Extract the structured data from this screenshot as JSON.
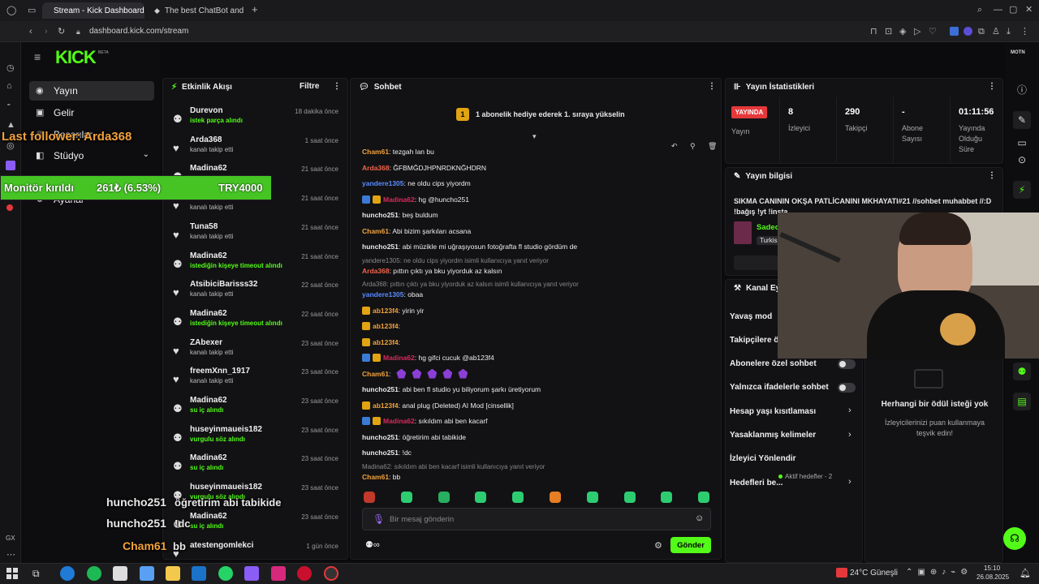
{
  "browser": {
    "tabs": [
      {
        "title": "Stream - Kick Dashboard"
      },
      {
        "title": "The best ChatBot and"
      }
    ],
    "new_tab": "+",
    "url": "dashboard.kick.com/stream"
  },
  "site": {
    "logo": "KICK",
    "beta": "BETA",
    "nav": [
      {
        "label": "Yayın",
        "icon": "broadcast-icon"
      },
      {
        "label": "Gelir",
        "icon": "wallet-icon"
      },
      {
        "label": "Başarılar",
        "icon": "trophy-icon"
      },
      {
        "label": "Stüdyo",
        "icon": "studio-icon"
      },
      {
        "label": "Ayarlar",
        "icon": "gear-icon"
      }
    ]
  },
  "activity": {
    "title": "Etkinlik Akışı",
    "filter": "Filtre",
    "items": [
      {
        "name": "Durevon",
        "sub": "istek parça alındı",
        "time": "18 dakika önce",
        "highlight": true,
        "icon": "reward-icon"
      },
      {
        "name": "Arda368",
        "sub": "kanalı takip etti",
        "time": "1 saat önce",
        "highlight": false,
        "icon": "heart-icon"
      },
      {
        "name": "Madina62",
        "sub": "",
        "time": "21 saat önce",
        "highlight": false,
        "icon": "reward-icon"
      },
      {
        "name": "Madina62",
        "sub": "kanalı takip etti",
        "time": "21 saat önce",
        "highlight": false,
        "icon": "heart-icon"
      },
      {
        "name": "Tuna58",
        "sub": "kanalı takip etti",
        "time": "21 saat önce",
        "highlight": false,
        "icon": "heart-icon"
      },
      {
        "name": "Madina62",
        "sub": "istediğin kişeye timeout alındı",
        "time": "21 saat önce",
        "highlight": true,
        "icon": "reward-icon"
      },
      {
        "name": "AtsibiciBarisss32",
        "sub": "kanalı takip etti",
        "time": "22 saat önce",
        "highlight": false,
        "icon": "heart-icon"
      },
      {
        "name": "Madina62",
        "sub": "istediğin kişeye timeout alındı",
        "time": "22 saat önce",
        "highlight": true,
        "icon": "reward-icon"
      },
      {
        "name": "ZAbexer",
        "sub": "kanalı takip etti",
        "time": "23 saat önce",
        "highlight": false,
        "icon": "heart-icon"
      },
      {
        "name": "freemXnn_1917",
        "sub": "kanalı takip etti",
        "time": "23 saat önce",
        "highlight": false,
        "icon": "heart-icon"
      },
      {
        "name": "Madina62",
        "sub": "su iç alındı",
        "time": "23 saat önce",
        "highlight": true,
        "icon": "reward-icon"
      },
      {
        "name": "huseyinmaueis182",
        "sub": "vurgulu söz alındı",
        "time": "23 saat önce",
        "highlight": true,
        "icon": "reward-icon"
      },
      {
        "name": "Madina62",
        "sub": "su iç alındı",
        "time": "23 saat önce",
        "highlight": true,
        "icon": "reward-icon"
      },
      {
        "name": "huseyinmaueis182",
        "sub": "vurgulu söz alındı",
        "time": "23 saat önce",
        "highlight": true,
        "icon": "reward-icon"
      },
      {
        "name": "Madina62",
        "sub": "su iç alındı",
        "time": "23 saat önce",
        "highlight": true,
        "icon": "reward-icon"
      },
      {
        "name": "atestengomlekci",
        "sub": "",
        "time": "1 gün önce",
        "highlight": false,
        "icon": "heart-icon"
      }
    ]
  },
  "chat": {
    "title": "Sohbet",
    "goal_number": "1",
    "goal_text": "1 abonelik hediye ederek 1. sıraya yükselin",
    "messages": [
      {
        "user": "Cham61",
        "color": "#f2a23c",
        "text": ": tezgah lan bu",
        "badges": []
      },
      {
        "user": "Arda368",
        "color": "#f0644a",
        "text": ": ĞFBMĞDJHPNRDKNĞHDRN",
        "badges": []
      },
      {
        "user": "yandere1305",
        "color": "#5b8cff",
        "text": ": ne oldu cips yiyordm",
        "badges": []
      },
      {
        "user": "Madina62",
        "color": "#d92a5c",
        "text": ": hg @huncho251",
        "badges": [
          "#3b7bd6",
          "#e2a312"
        ]
      },
      {
        "user": "huncho251",
        "color": "#e8e8e8",
        "text": ": beş buldum",
        "badges": []
      },
      {
        "user": "Cham61",
        "color": "#f2a23c",
        "text": ": Abi bizim şarkıları acsana",
        "badges": []
      },
      {
        "user": "huncho251",
        "color": "#e8e8e8",
        "text": ": abi müzikle mi uğraşıyosun fotoğrafta fl studio gördüm de",
        "badges": []
      },
      {
        "reply": "yandere1305: ne oldu cips yiyordm isimli kullanıcıya yanıt veriyor",
        "user": "Arda368",
        "color": "#f0644a",
        "text": ": pıttın çıktı ya bku yiyorduk az kalsın",
        "badges": []
      },
      {
        "reply": "Arda368: pıttın çıktı ya bku yiyorduk az kalsın isimli kullanıcıya yanıt veriyor",
        "user": "yandere1305",
        "color": "#5b8cff",
        "text": ": obaa",
        "badges": []
      },
      {
        "user": "ab123f4",
        "color": "#f2a23c",
        "text": ": yirin yir",
        "badges": [
          "#e2a312"
        ]
      },
      {
        "user": "ab123f4",
        "color": "#f2a23c",
        "text": ": ",
        "badges": [
          "#e2a312"
        ]
      },
      {
        "user": "ab123f4",
        "color": "#f2a23c",
        "text": ": ",
        "badges": [
          "#e2a312"
        ]
      },
      {
        "user": "Madina62",
        "color": "#d92a5c",
        "text": ": hg gifci cucuk @ab123f4",
        "badges": [
          "#3b7bd6",
          "#e2a312"
        ]
      },
      {
        "user": "Cham61",
        "color": "#f2a23c",
        "text": ":",
        "badges": []
      },
      {
        "user": "huncho251",
        "color": "#e8e8e8",
        "text": ": abi ben fl studio yu biliyorum şarkı üretiyorum",
        "badges": []
      },
      {
        "user": "ab123f4",
        "color": "#f2a23c",
        "text": ": anal plug (Deleted)  AI Mod  [cinsellik]",
        "badges": [
          "#e2a312"
        ]
      },
      {
        "user": "Madina62",
        "color": "#d92a5c",
        "text": ": sıkıldım abi ben kacarf",
        "badges": [
          "#3b7bd6",
          "#e2a312"
        ]
      },
      {
        "user": "huncho251",
        "color": "#e8e8e8",
        "text": ": öğretirim abi tabikide",
        "badges": []
      },
      {
        "user": "huncho251",
        "color": "#e8e8e8",
        "text": ": !dc",
        "badges": []
      },
      {
        "reply": "Madina62: sıkıldım abi ben kacarf isimli kullanıcıya yanıt veriyor",
        "user": "Cham61",
        "color": "#f2a23c",
        "text": ": bb",
        "badges": []
      }
    ],
    "input_placeholder": "Bir mesaj gönderin",
    "send": "Gönder"
  },
  "stats": {
    "title": "Yayın İstatistikleri",
    "live": "YAYINDA",
    "live_label": "Yayın",
    "items": [
      {
        "value": "8",
        "label": "İzleyici"
      },
      {
        "value": "290",
        "label": "Takipçi"
      },
      {
        "value": "-",
        "label": "Abone Sayısı"
      },
      {
        "value": "01:11:56",
        "label": "Yayında Olduğu Süre"
      }
    ]
  },
  "stream_info": {
    "title": "Yayın bilgisi",
    "text": "SIKMA CANININ OKŞA PATLİCANINI MKHAYATI#21 //sohbet muhabbet //:D !bağış !yt !insta",
    "category": "Sadec",
    "language": "Turkish"
  },
  "channel_actions": {
    "title": "Kanal Eyle",
    "items": [
      {
        "label": "Yavaş mod",
        "control": "none"
      },
      {
        "label": "Takipçilere ö",
        "control": "none"
      },
      {
        "label": "Abonelere özel sohbet",
        "control": "toggle"
      },
      {
        "label": "Yalnızca ifadelerle sohbet",
        "control": "toggle"
      },
      {
        "label": "Hesap yaşı kısıtlaması",
        "control": "chevron"
      },
      {
        "label": "Yasaklanmış kelimeler",
        "control": "chevron"
      },
      {
        "label": "İzleyici Yönlendir",
        "control": "none"
      },
      {
        "label": "Hedefleri be...",
        "control": "chevron"
      }
    ],
    "goals_active": "Aktif hedefler - 2"
  },
  "rewards": {
    "empty_title": "Herhangi bir ödül isteği yok",
    "empty_text": "İzleyicilerinizi puan kullanmaya teşvik edin!"
  },
  "overlay": {
    "last_follower": "Last follower: Arda368",
    "goal_label": "Monitör kırıldı",
    "goal_progress": "261₺ (6.53%)",
    "goal_target": "TRY4000",
    "goal_fraction": 0.0653,
    "chat": [
      {
        "user": "huncho251",
        "text": "öğretirim abi tabikide"
      },
      {
        "user": "huncho251",
        "text": "!dc"
      },
      {
        "user": "Cham61",
        "text": "bb"
      }
    ]
  },
  "taskbar": {
    "weather": "24°C  Güneşli",
    "time": "15:10",
    "date": "26.08.2025"
  },
  "colors": {
    "kick_green": "#53fc18",
    "live_red": "#e5383b",
    "panel_bg": "#121214"
  }
}
